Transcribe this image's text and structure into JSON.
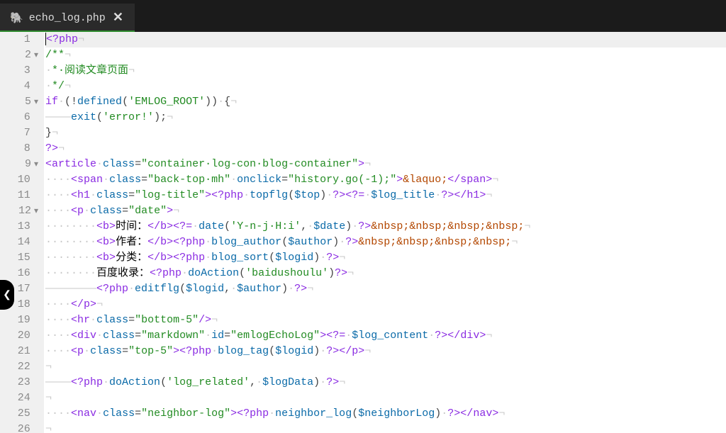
{
  "tab": {
    "icon": "🐘",
    "filename": "echo_log.php",
    "close": "✕"
  },
  "side_handle": "❮",
  "gutter": [
    {
      "n": "1",
      "fold": ""
    },
    {
      "n": "2",
      "fold": "▾"
    },
    {
      "n": "3",
      "fold": ""
    },
    {
      "n": "4",
      "fold": ""
    },
    {
      "n": "5",
      "fold": "▾"
    },
    {
      "n": "6",
      "fold": ""
    },
    {
      "n": "7",
      "fold": ""
    },
    {
      "n": "8",
      "fold": ""
    },
    {
      "n": "9",
      "fold": "▾"
    },
    {
      "n": "10",
      "fold": ""
    },
    {
      "n": "11",
      "fold": ""
    },
    {
      "n": "12",
      "fold": "▾"
    },
    {
      "n": "13",
      "fold": ""
    },
    {
      "n": "14",
      "fold": ""
    },
    {
      "n": "15",
      "fold": ""
    },
    {
      "n": "16",
      "fold": ""
    },
    {
      "n": "17",
      "fold": ""
    },
    {
      "n": "18",
      "fold": ""
    },
    {
      "n": "19",
      "fold": ""
    },
    {
      "n": "20",
      "fold": ""
    },
    {
      "n": "21",
      "fold": ""
    },
    {
      "n": "22",
      "fold": ""
    },
    {
      "n": "23",
      "fold": ""
    },
    {
      "n": "24",
      "fold": ""
    },
    {
      "n": "25",
      "fold": ""
    },
    {
      "n": "26",
      "fold": ""
    }
  ],
  "code": {
    "l1": {
      "phpopen": "<?php",
      "eol": "¬"
    },
    "l2": {
      "c": "/**",
      "eol": "¬"
    },
    "l3": {
      "dot": "·",
      "c": "*·阅读文章页面",
      "eol": "¬"
    },
    "l4": {
      "dot": "·",
      "c": "*/",
      "eol": "¬"
    },
    "l5": {
      "kw": "if",
      "sp": "·",
      "p1": "(!",
      "fn": "defined",
      "p2": "(",
      "s": "'EMLOG_ROOT'",
      "p3": "))",
      "sp2": "·",
      "br": "{",
      "eol": "¬"
    },
    "l6": {
      "ind": "————",
      "fn": "exit",
      "p1": "(",
      "s": "'error!'",
      "p2": ");",
      "eol": "¬"
    },
    "l7": {
      "br": "}",
      "eol": "¬"
    },
    "l8": {
      "phpclose": "?>",
      "eol": "¬"
    },
    "l9": {
      "open": "<",
      "tag": "article",
      "sp": "·",
      "a1": "class",
      "eq": "=",
      "v1": "\"container·log-con·blog-container\"",
      "close": ">",
      "eol": "¬"
    },
    "l10": {
      "ind": "····",
      "open": "<",
      "tag": "span",
      "sp": "·",
      "a1": "class",
      "eq": "=",
      "v1": "\"back-top·mh\"",
      "sp2": "·",
      "a2": "onclick",
      "eq2": "=",
      "v2": "\"history.go(-1);\"",
      "close": ">",
      "ent": "&laquo;",
      "copen": "</",
      "ctag": "span",
      "cclose": ">",
      "eol": "¬"
    },
    "l11": {
      "ind": "····",
      "open": "<",
      "tag": "h1",
      "sp": "·",
      "a1": "class",
      "eq": "=",
      "v1": "\"log-title\"",
      "close": ">",
      "php1": "<?php",
      "sp2": "·",
      "fn": "topflg",
      "p1": "(",
      "var": "$top",
      "p2": ")",
      "sp3": "·",
      "phpend": "?>",
      "php2": "<?=",
      "sp4": "·",
      "var2": "$log_title",
      "sp5": "·",
      "phpend2": "?>",
      "copen": "</",
      "ctag": "h1",
      "cclose": ">",
      "eol": "¬"
    },
    "l12": {
      "ind": "····",
      "open": "<",
      "tag": "p",
      "sp": "·",
      "a1": "class",
      "eq": "=",
      "v1": "\"date\"",
      "close": ">",
      "eol": "¬"
    },
    "l13": {
      "ind": "········",
      "open": "<",
      "tag": "b",
      "close": ">",
      "txt": "时间：",
      "copen": "</",
      "ctag": "b",
      "cclose": ">",
      "php": "<?=",
      "sp": "·",
      "fn": "date",
      "p1": "(",
      "s": "'Y-n-j·H:i'",
      "c": ",",
      "sp2": "·",
      "var": "$date",
      "p2": ")",
      "sp3": "·",
      "phpend": "?>",
      "ent": "&nbsp;&nbsp;&nbsp;&nbsp;",
      "eol": "¬"
    },
    "l14": {
      "ind": "········",
      "open": "<",
      "tag": "b",
      "close": ">",
      "txt": "作者：",
      "copen": "</",
      "ctag": "b",
      "cclose": ">",
      "php": "<?php",
      "sp": "·",
      "fn": "blog_author",
      "p1": "(",
      "var": "$author",
      "p2": ")",
      "sp2": "·",
      "phpend": "?>",
      "ent": "&nbsp;&nbsp;&nbsp;&nbsp;",
      "eol": "¬"
    },
    "l15": {
      "ind": "········",
      "open": "<",
      "tag": "b",
      "close": ">",
      "txt": "分类：",
      "copen": "</",
      "ctag": "b",
      "cclose": ">",
      "php": "<?php",
      "sp": "·",
      "fn": "blog_sort",
      "p1": "(",
      "var": "$logid",
      "p2": ")",
      "sp2": "·",
      "phpend": "?>",
      "eol": "¬"
    },
    "l16": {
      "ind": "········",
      "txt": "百度收录：",
      "php": "<?php",
      "sp": "·",
      "fn": "doAction",
      "p1": "(",
      "s": "'baidushoulu'",
      "p2": ")",
      "phpend": "?>",
      "eol": "¬"
    },
    "l17": {
      "ind": "————————",
      "php": "<?php",
      "sp": "·",
      "fn": "editflg",
      "p1": "(",
      "var": "$logid",
      "c": ",",
      "sp2": "·",
      "var2": "$author",
      "p2": ")",
      "sp3": "·",
      "phpend": "?>",
      "eol": "¬"
    },
    "l18": {
      "ind": "····",
      "copen": "</",
      "ctag": "p",
      "cclose": ">",
      "eol": "¬"
    },
    "l19": {
      "ind": "····",
      "open": "<",
      "tag": "hr",
      "sp": "·",
      "a1": "class",
      "eq": "=",
      "v1": "\"bottom-5\"",
      "close": "/>",
      "eol": "¬"
    },
    "l20": {
      "ind": "····",
      "open": "<",
      "tag": "div",
      "sp": "·",
      "a1": "class",
      "eq": "=",
      "v1": "\"markdown\"",
      "sp2": "·",
      "a2": "id",
      "eq2": "=",
      "v2": "\"emlogEchoLog\"",
      "close": ">",
      "php": "<?=",
      "sp3": "·",
      "var": "$log_content",
      "sp4": "·",
      "phpend": "?>",
      "copen": "</",
      "ctag": "div",
      "cclose": ">",
      "eol": "¬"
    },
    "l21": {
      "ind": "····",
      "open": "<",
      "tag": "p",
      "sp": "·",
      "a1": "class",
      "eq": "=",
      "v1": "\"top-5\"",
      "close": ">",
      "php": "<?php",
      "sp2": "·",
      "fn": "blog_tag",
      "p1": "(",
      "var": "$logid",
      "p2": ")",
      "sp3": "·",
      "phpend": "?>",
      "copen": "</",
      "ctag": "p",
      "cclose": ">",
      "eol": "¬"
    },
    "l22": {
      "ind": "",
      "eol": "¬"
    },
    "l23": {
      "ind": "————",
      "php": "<?php",
      "sp": "·",
      "fn": "doAction",
      "p1": "(",
      "s": "'log_related'",
      "c": ",",
      "sp2": "·",
      "var": "$logData",
      "p2": ")",
      "sp3": "·",
      "phpend": "?>",
      "eol": "¬"
    },
    "l24": {
      "ind": "",
      "eol": "¬"
    },
    "l25": {
      "ind": "····",
      "open": "<",
      "tag": "nav",
      "sp": "·",
      "a1": "class",
      "eq": "=",
      "v1": "\"neighbor-log\"",
      "close": ">",
      "php": "<?php",
      "sp2": "·",
      "fn": "neighbor_log",
      "p1": "(",
      "var": "$neighborLog",
      "p2": ")",
      "sp3": "·",
      "phpend": "?>",
      "copen": "</",
      "ctag": "nav",
      "cclose": ">",
      "eol": "¬"
    },
    "l26": {
      "ind": "",
      "eol": "¬"
    }
  }
}
